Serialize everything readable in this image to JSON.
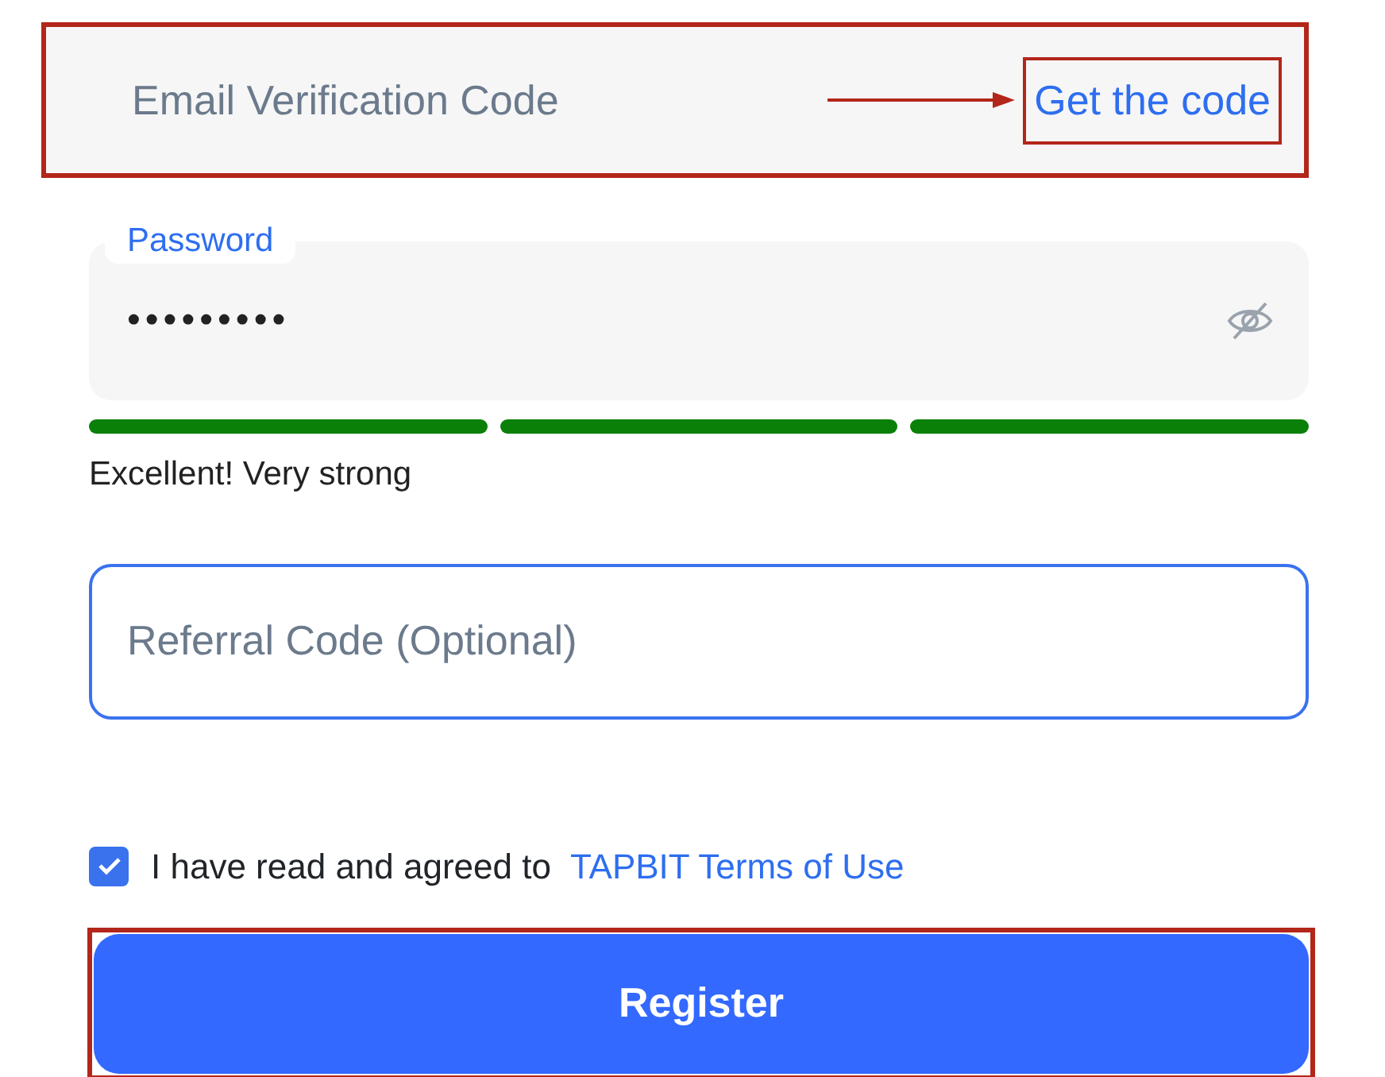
{
  "email_code_field": {
    "placeholder": "Email Verification Code",
    "highlighted": true,
    "action_link": {
      "label": "Get the code",
      "highlighted": true
    }
  },
  "password_field": {
    "label": "Password",
    "value": "•••••••••"
  },
  "strength": {
    "segments": [
      {
        "filled": true
      },
      {
        "filled": true
      },
      {
        "filled": true
      }
    ],
    "message": "Excellent! Very strong"
  },
  "referral_field": {
    "placeholder": "Referral Code (Optional)"
  },
  "terms": {
    "checked": true,
    "text": "I have read and agreed to",
    "link": "TAPBIT Terms of Use"
  },
  "register_button": {
    "label": "Register",
    "highlighted": true
  }
}
